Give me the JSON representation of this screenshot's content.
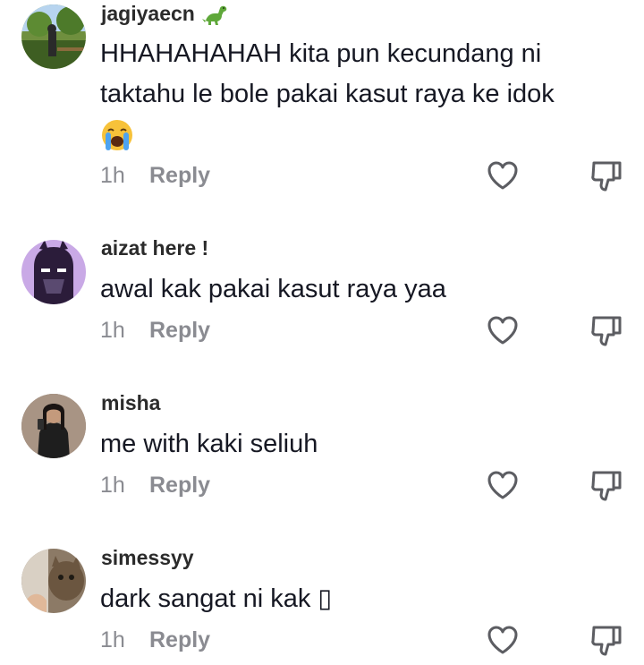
{
  "comments": [
    {
      "username": "jagiyaecn",
      "badge_icon": "dinosaur-icon",
      "text": "HHAHAHAHAH kita pun kecundang ni taktahu le bole pakai kasut raya ke idok",
      "emoji_icon": "loudly-crying-face-icon",
      "time": "1h",
      "reply_label": "Reply"
    },
    {
      "username": "aizat here !",
      "text": "awal kak pakai kasut raya yaa",
      "time": "1h",
      "reply_label": "Reply"
    },
    {
      "username": "misha",
      "text": "me with kaki seliuh",
      "time": "1h",
      "reply_label": "Reply"
    },
    {
      "username": "simessyy",
      "text": "dark sangat ni kak ▯",
      "time": "1h",
      "reply_label": "Reply"
    }
  ],
  "colors": {
    "text": "#161823",
    "secondary": "#8a8b91",
    "icon_stroke": "#5c5d62"
  }
}
